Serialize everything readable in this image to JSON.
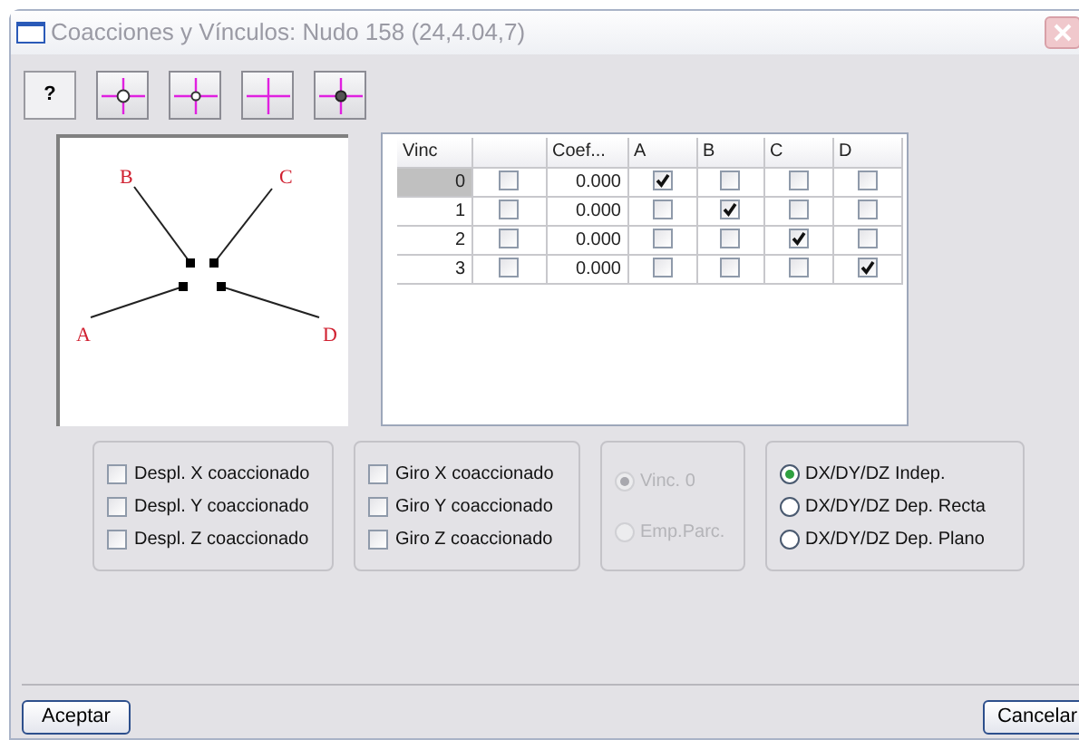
{
  "window": {
    "title": "Coacciones y Vínculos: Nudo 158 (24,4.04,7)"
  },
  "toolbar": [
    {
      "kind": "text",
      "label": "?",
      "selected": true
    },
    {
      "kind": "ring",
      "selected": false
    },
    {
      "kind": "small-ring",
      "selected": false
    },
    {
      "kind": "cross",
      "selected": false
    },
    {
      "kind": "dot",
      "selected": false
    }
  ],
  "diagram": {
    "labels": [
      "A",
      "B",
      "C",
      "D"
    ]
  },
  "table": {
    "columns": [
      "Vinc",
      "",
      "Coef...",
      "A",
      "B",
      "C",
      "D"
    ],
    "rows": [
      {
        "vinc": "0",
        "selected": true,
        "flag": false,
        "coef": "0.000",
        "a": true,
        "b": false,
        "c": false,
        "d": false
      },
      {
        "vinc": "1",
        "selected": false,
        "flag": false,
        "coef": "0.000",
        "a": false,
        "b": true,
        "c": false,
        "d": false
      },
      {
        "vinc": "2",
        "selected": false,
        "flag": false,
        "coef": "0.000",
        "a": false,
        "b": false,
        "c": true,
        "d": false
      },
      {
        "vinc": "3",
        "selected": false,
        "flag": false,
        "coef": "0.000",
        "a": false,
        "b": false,
        "c": false,
        "d": true
      }
    ]
  },
  "displacement": [
    {
      "label": "Despl. X coaccionado",
      "checked": false
    },
    {
      "label": "Despl. Y coaccionado",
      "checked": false
    },
    {
      "label": "Despl. Z coaccionado",
      "checked": false
    }
  ],
  "rotation": [
    {
      "label": "Giro X coaccionado",
      "checked": false
    },
    {
      "label": "Giro Y coaccionado",
      "checked": false
    },
    {
      "label": "Giro Z coaccionado",
      "checked": false
    }
  ],
  "link_type": {
    "disabled": true,
    "options": [
      {
        "label": "Vinc. 0",
        "selected": true
      },
      {
        "label": "Emp.Parc.",
        "selected": false
      }
    ]
  },
  "dependency": {
    "disabled": false,
    "options": [
      {
        "label": "DX/DY/DZ Indep.",
        "selected": true
      },
      {
        "label": "DX/DY/DZ Dep. Recta",
        "selected": false
      },
      {
        "label": "DX/DY/DZ Dep. Plano",
        "selected": false
      }
    ]
  },
  "buttons": {
    "ok": "Aceptar",
    "cancel": "Cancelar"
  }
}
